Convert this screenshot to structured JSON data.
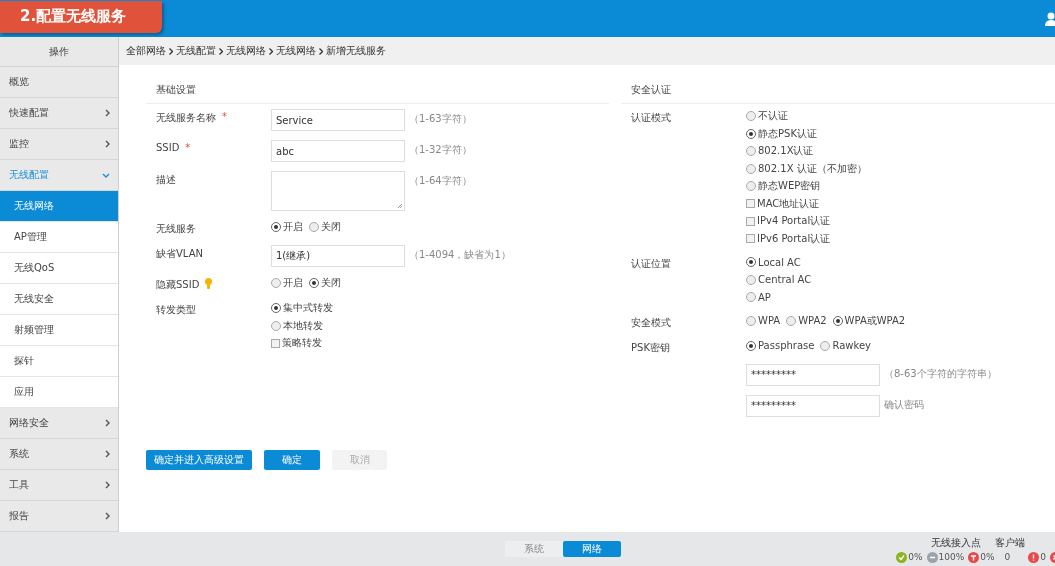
{
  "banner": {
    "title": "2.配置无线服务"
  },
  "sidebar": {
    "header": "操作",
    "items": [
      {
        "label": "概览",
        "kind": "link"
      },
      {
        "label": "快速配置",
        "kind": "group",
        "expanded": false
      },
      {
        "label": "监控",
        "kind": "group",
        "expanded": false
      },
      {
        "label": "无线配置",
        "kind": "group",
        "expanded": true,
        "children": [
          {
            "label": "无线网络",
            "selected": true
          },
          {
            "label": "AP管理",
            "selected": false
          },
          {
            "label": "无线QoS",
            "selected": false
          },
          {
            "label": "无线安全",
            "selected": false
          },
          {
            "label": "射频管理",
            "selected": false
          },
          {
            "label": "探针",
            "selected": false
          },
          {
            "label": "应用",
            "selected": false
          }
        ]
      },
      {
        "label": "网络安全",
        "kind": "group",
        "expanded": false
      },
      {
        "label": "系统",
        "kind": "group",
        "expanded": false
      },
      {
        "label": "工具",
        "kind": "group",
        "expanded": false
      },
      {
        "label": "报告",
        "kind": "group",
        "expanded": false
      }
    ]
  },
  "breadcrumb": [
    "全部网络",
    "无线配置",
    "无线网络",
    "无线网络",
    "新增无线服务"
  ],
  "basic": {
    "title": "基础设置",
    "rows": [
      {
        "kind": "input",
        "label": "无线服务名称",
        "marker": "*",
        "value": "Service",
        "hint": "（1-63字符）"
      },
      {
        "kind": "input",
        "label": "SSID",
        "marker": "*",
        "value": "abc",
        "hint": "（1-32字符）"
      },
      {
        "kind": "textarea",
        "label": "描述",
        "hint": "（1-64字符）"
      },
      {
        "kind": "choices_row",
        "label": "无线服务",
        "options": [
          {
            "kind": "radio",
            "label": "开启",
            "selected": true
          },
          {
            "kind": "radio",
            "label": "关闭",
            "selected": false
          }
        ]
      },
      {
        "kind": "input",
        "label": "缺省VLAN",
        "value": "1(继承)",
        "hint": "（1-4094，缺省为1）"
      },
      {
        "kind": "choices_row",
        "label": "隐藏SSID",
        "tip": true,
        "options": [
          {
            "kind": "radio",
            "label": "开启",
            "selected": false
          },
          {
            "kind": "radio",
            "label": "关闭",
            "selected": true
          }
        ]
      },
      {
        "kind": "choices_column",
        "label": "转发类型",
        "options": [
          {
            "kind": "radio",
            "label": "集中式转发",
            "selected": true
          },
          {
            "kind": "radio",
            "label": "本地转发",
            "selected": false
          },
          {
            "kind": "checkbox",
            "label": "策略转发",
            "checked": false
          }
        ]
      }
    ]
  },
  "security": {
    "title": "安全认证",
    "rows": [
      {
        "kind": "choices_column",
        "label": "认证模式",
        "options": [
          {
            "kind": "radio",
            "label": "不认证",
            "selected": false
          },
          {
            "kind": "radio",
            "label": "静态PSK认证",
            "selected": true
          },
          {
            "kind": "radio",
            "label": "802.1X认证",
            "selected": false
          },
          {
            "kind": "radio",
            "label": "802.1X 认证（不加密）",
            "selected": false
          },
          {
            "kind": "radio",
            "label": "静态WEP密钥",
            "selected": false
          },
          {
            "kind": "checkbox",
            "label": "MAC地址认证",
            "checked": false
          },
          {
            "kind": "checkbox",
            "label": "IPv4 Portal认证",
            "checked": false
          },
          {
            "kind": "checkbox",
            "label": "IPv6 Portal认证",
            "checked": false
          }
        ]
      },
      {
        "kind": "choices_column",
        "label": "认证位置",
        "options": [
          {
            "kind": "radio",
            "label": "Local AC",
            "selected": true
          },
          {
            "kind": "radio",
            "label": "Central AC",
            "selected": false
          },
          {
            "kind": "radio",
            "label": "AP",
            "selected": false
          }
        ]
      },
      {
        "kind": "choices_row",
        "label": "安全模式",
        "options": [
          {
            "kind": "radio",
            "label": "WPA",
            "selected": false
          },
          {
            "kind": "radio",
            "label": "WPA2",
            "selected": false
          },
          {
            "kind": "radio",
            "label": "WPA或WPA2",
            "selected": true
          }
        ]
      },
      {
        "kind": "choices_row",
        "label": "PSK密钥",
        "options": [
          {
            "kind": "radio",
            "label": "Passphrase",
            "selected": true
          },
          {
            "kind": "radio",
            "label": "Rawkey",
            "selected": false
          }
        ]
      },
      {
        "kind": "input",
        "value": "*********",
        "hint": "（8-63个字符的字符串）"
      },
      {
        "kind": "input",
        "value": "*********",
        "hint": "确认密码"
      }
    ]
  },
  "buttons": [
    {
      "label": "确定并进入高级设置",
      "kind": "primary"
    },
    {
      "label": "确定",
      "kind": "primary"
    },
    {
      "label": "取消",
      "kind": "disabled"
    }
  ],
  "bottom_tabs": [
    {
      "label": "系统",
      "selected": false
    },
    {
      "label": "网络",
      "selected": true
    }
  ],
  "status": {
    "headings": [
      "无线接入点",
      "客户端"
    ],
    "ap": [
      {
        "kind": "ok",
        "value": "0%"
      },
      {
        "kind": "minus",
        "value": "100%"
      },
      {
        "kind": "alert",
        "value": "0%"
      }
    ],
    "client_count": "0",
    "alarms": [
      {
        "kind": "error",
        "value": "0"
      },
      {
        "kind": "close"
      }
    ]
  }
}
